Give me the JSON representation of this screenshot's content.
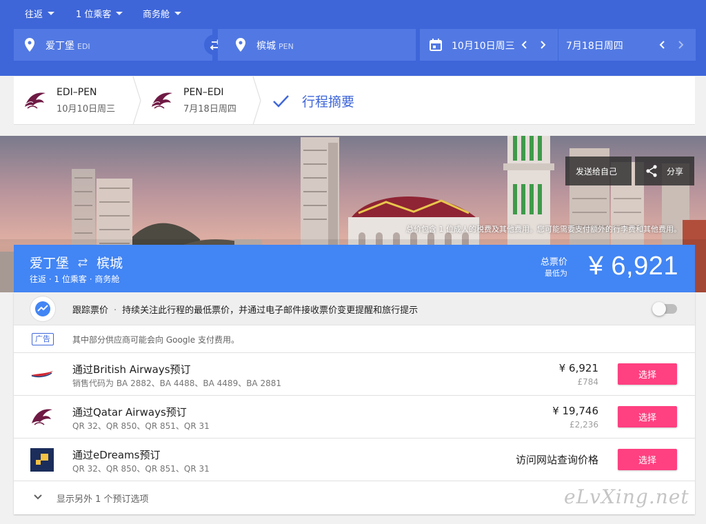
{
  "search_options": {
    "trip_type": "往返",
    "passengers": "1 位乘客",
    "cabin": "商务舱"
  },
  "origin": {
    "city": "爱丁堡",
    "code": "EDI"
  },
  "destination": {
    "city": "槟城",
    "code": "PEN"
  },
  "dates": {
    "depart": "10月10日周三",
    "return": "7月18日周四"
  },
  "steps": [
    {
      "route": "EDI–PEN",
      "date": "10月10日周三"
    },
    {
      "route": "PEN–EDI",
      "date": "7月18日周四"
    }
  ],
  "summary_label": "行程摘要",
  "banner": {
    "send_to_self": "发送给自己",
    "share": "分享",
    "tax_note": "总价包含 1 位成人的税费及其他费用。您可能需要支付额外的行李费和其他费用。"
  },
  "price_bar": {
    "from": "爱丁堡",
    "to": "槟城",
    "subtitle": "往返 · 1 位乘客 · 商务舱",
    "total_label": "总票价",
    "lowest_label": "最低为",
    "price": "¥ 6,921"
  },
  "tracking": {
    "title": "跟踪票价",
    "description": "持续关注此行程的最低票价，并通过电子邮件接收票价变更提醒和旅行提示",
    "enabled": false
  },
  "ad": {
    "badge": "广告",
    "text": "其中部分供应商可能会向 Google 支付费用。"
  },
  "offers": [
    {
      "name": "通过British Airways预订",
      "codes": "销售代码为 BA 2882、BA 4488、BA 4489、BA 2881",
      "price": "¥ 6,921",
      "sub_price": "£784",
      "select": "选择",
      "logo": "british-airways"
    },
    {
      "name": "通过Qatar Airways预订",
      "codes": "QR 32、QR 850、QR 851、QR 31",
      "price": "¥ 19,746",
      "sub_price": "£2,236",
      "select": "选择",
      "logo": "qatar-airways"
    },
    {
      "name": "通过eDreams预订",
      "codes": "QR 32、QR 850、QR 851、QR 31",
      "visit": "访问网站查询价格",
      "select": "选择",
      "logo": "edreams"
    }
  ],
  "show_more": "显示另外 1 个预订选项",
  "watermark": "eLvXing.net",
  "colors": {
    "header_blue": "#3e66d9",
    "field_blue": "#5279e3",
    "price_bar_blue": "#4285f4",
    "select_pink": "#ff4081",
    "qatar_maroon": "#6f1a44"
  }
}
